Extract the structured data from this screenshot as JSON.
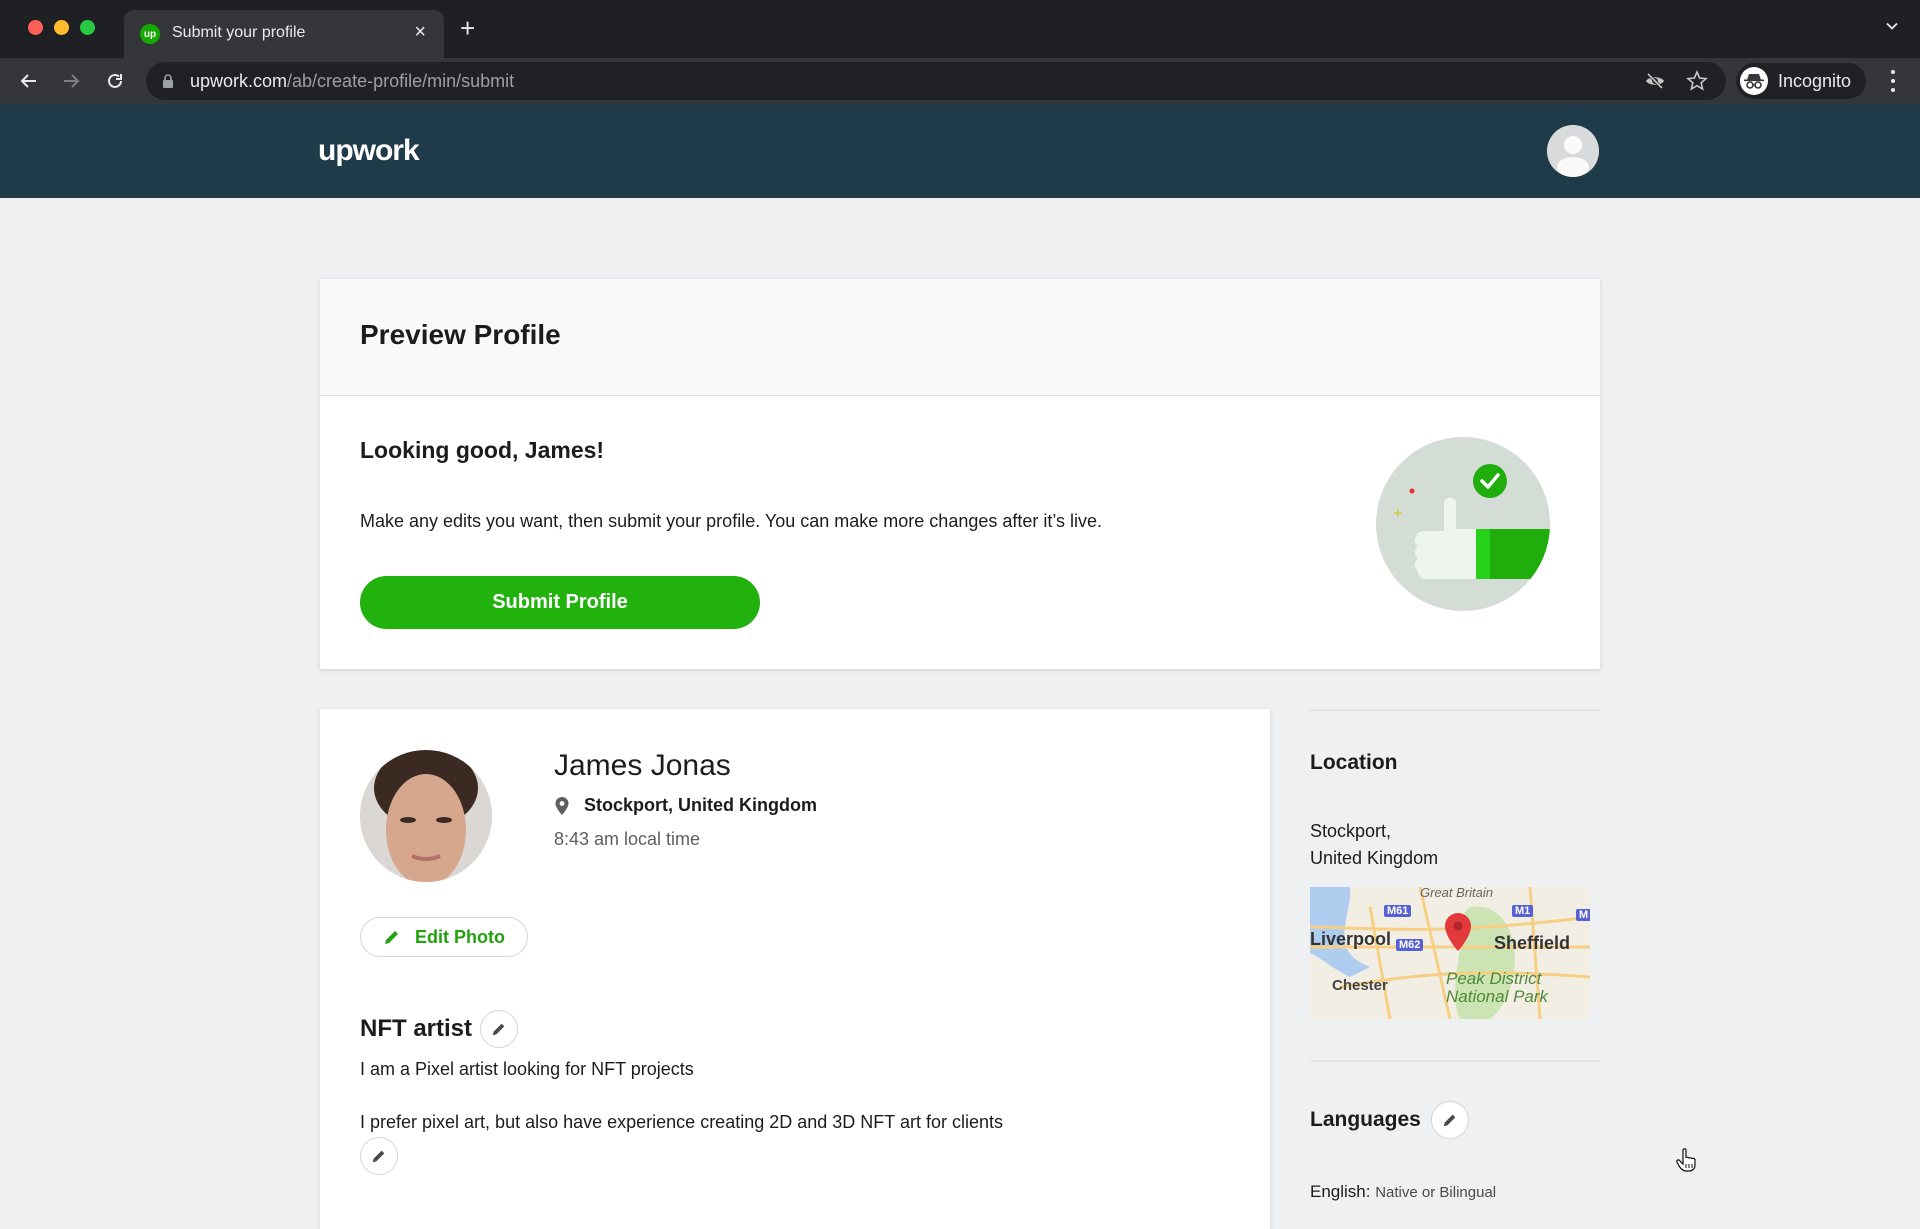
{
  "browser": {
    "tab_title": "Submit your profile",
    "favicon_text": "up",
    "url_host": "upwork.com",
    "url_path": "/ab/create-profile/min/submit",
    "profile_label": "Incognito"
  },
  "header": {
    "logo": "upwork"
  },
  "preview": {
    "title": "Preview Profile",
    "greeting": "Looking good, James!",
    "description": "Make any edits you want, then submit your profile. You can make more changes after it’s live.",
    "submit_label": "Submit Profile"
  },
  "profile": {
    "name": "James Jonas",
    "location": "Stockport, United Kingdom",
    "local_time": "8:43 am local time",
    "edit_photo_label": "Edit Photo",
    "title": "NFT artist",
    "overview_lines": [
      "I am a Pixel artist looking for NFT projects",
      "I prefer pixel art, but also have experience creating 2D and 3D NFT art for clients"
    ]
  },
  "sidebar": {
    "location_heading": "Location",
    "location_city": "Stockport,",
    "location_country": "United Kingdom",
    "map_labels": {
      "region": "Great Britain",
      "city_1": "Liverpool",
      "city_2": "Sheffield",
      "city_3": "Chester",
      "park_line_1": "Peak District",
      "park_line_2": "National Park",
      "road_1": "M61",
      "road_2": "M62",
      "road_3": "M1",
      "road_4": "M"
    },
    "languages_heading": "Languages",
    "languages": [
      {
        "name": "English:",
        "level": "Native or Bilingual"
      }
    ]
  },
  "colors": {
    "brand_green": "#22b20e",
    "header_bg": "#1f3b4a",
    "page_bg": "#eff0f2"
  }
}
